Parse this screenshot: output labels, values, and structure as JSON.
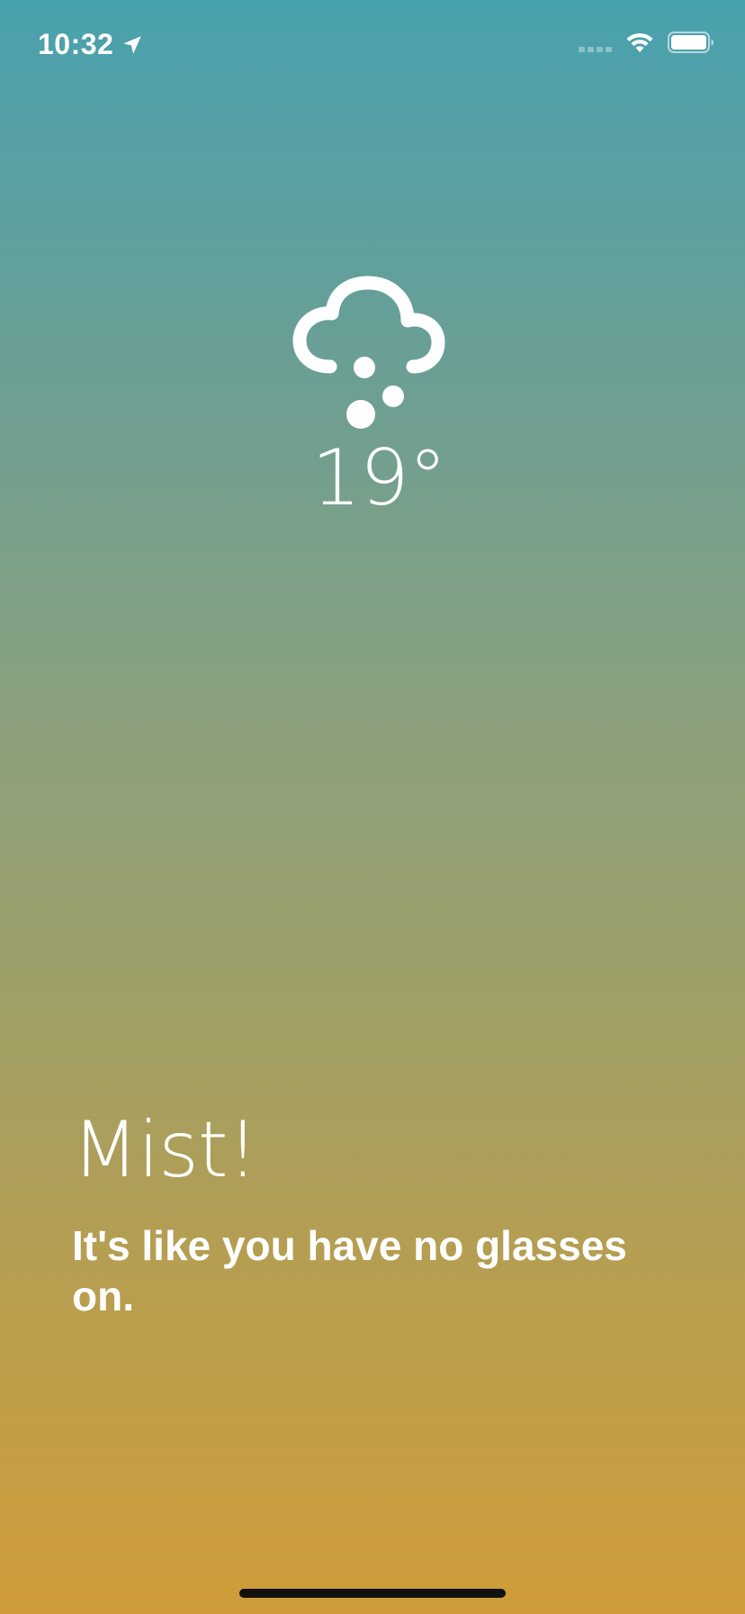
{
  "status_bar": {
    "time": "10:32",
    "location_icon": "location-arrow-icon",
    "signal_icon": "cellular-signal-icon",
    "wifi_icon": "wifi-icon",
    "battery_icon": "battery-icon"
  },
  "weather": {
    "icon": "cloud-hail-icon",
    "temperature": "19°"
  },
  "message": {
    "title": "Mist!",
    "body": "It's like you have no glasses on."
  },
  "colors": {
    "gradient_top": "#48a1ae",
    "gradient_bottom": "#cf9c39",
    "text": "#ffffff",
    "home_indicator": "#111111"
  }
}
